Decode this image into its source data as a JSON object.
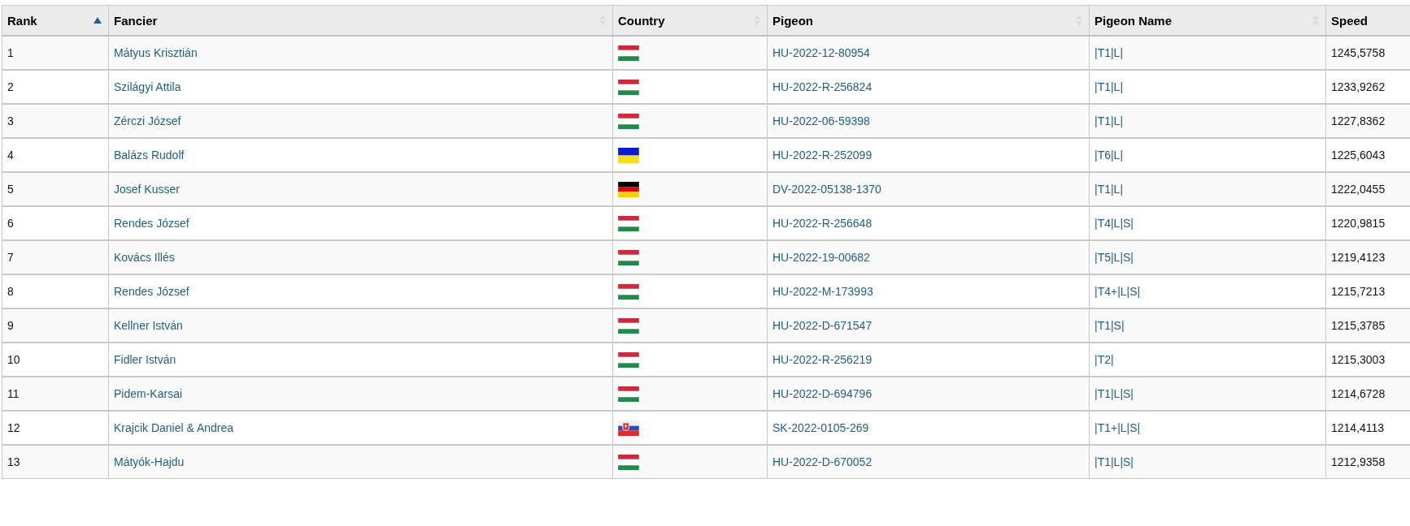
{
  "table": {
    "columns": [
      {
        "label": "Rank",
        "kind": "sorted"
      },
      {
        "label": "Fancier",
        "kind": "sortable"
      },
      {
        "label": "Country",
        "kind": "sortable"
      },
      {
        "label": "Pigeon",
        "kind": "sortable"
      },
      {
        "label": "Pigeon Name",
        "kind": "sortable"
      },
      {
        "label": "Speed",
        "kind": "plain"
      }
    ],
    "rows": [
      {
        "rank": "1",
        "fancier": "Mátyus Krisztián",
        "kind": "hu",
        "pigeon": "HU-2022-12-80954",
        "pigeon_name": "|T1|L|",
        "speed": "1245,5758"
      },
      {
        "rank": "2",
        "fancier": "Szilágyi Attila",
        "kind": "hu",
        "pigeon": "HU-2022-R-256824",
        "pigeon_name": "|T1|L|",
        "speed": "1233,9262"
      },
      {
        "rank": "3",
        "fancier": "Zérczi József",
        "kind": "hu",
        "pigeon": "HU-2022-06-59398",
        "pigeon_name": "|T1|L|",
        "speed": "1227,8362"
      },
      {
        "rank": "4",
        "fancier": "Balázs Rudolf",
        "kind": "ua",
        "pigeon": "HU-2022-R-252099",
        "pigeon_name": "|T6|L|",
        "speed": "1225,6043"
      },
      {
        "rank": "5",
        "fancier": "Josef Kusser",
        "kind": "de",
        "pigeon": "DV-2022-05138-1370",
        "pigeon_name": "|T1|L|",
        "speed": "1222,0455"
      },
      {
        "rank": "6",
        "fancier": "Rendes József",
        "kind": "hu",
        "pigeon": "HU-2022-R-256648",
        "pigeon_name": "|T4|L|S|",
        "speed": "1220,9815"
      },
      {
        "rank": "7",
        "fancier": "Kovács Illés",
        "kind": "hu",
        "pigeon": "HU-2022-19-00682",
        "pigeon_name": "|T5|L|S|",
        "speed": "1219,4123"
      },
      {
        "rank": "8",
        "fancier": "Rendes József",
        "kind": "hu",
        "pigeon": "HU-2022-M-173993",
        "pigeon_name": "|T4+|L|S|",
        "speed": "1215,7213"
      },
      {
        "rank": "9",
        "fancier": "Kellner István",
        "kind": "hu",
        "pigeon": "HU-2022-D-671547",
        "pigeon_name": "|T1|S|",
        "speed": "1215,3785"
      },
      {
        "rank": "10",
        "fancier": "Fidler István",
        "kind": "hu",
        "pigeon": "HU-2022-R-256219",
        "pigeon_name": "|T2|",
        "speed": "1215,3003"
      },
      {
        "rank": "11",
        "fancier": "Pidem-Karsai",
        "kind": "hu",
        "pigeon": "HU-2022-D-694796",
        "pigeon_name": "|T1|L|S|",
        "speed": "1214,6728"
      },
      {
        "rank": "12",
        "fancier": "Krajcik Daniel & Andrea",
        "kind": "sk",
        "pigeon": "SK-2022-0105-269",
        "pigeon_name": "|T1+|L|S|",
        "speed": "1214,4113"
      },
      {
        "rank": "13",
        "fancier": "Mátyók-Hajdu",
        "kind": "hu",
        "pigeon": "HU-2022-D-670052",
        "pigeon_name": "|T1|L|S|",
        "speed": "1212,9358"
      }
    ]
  }
}
